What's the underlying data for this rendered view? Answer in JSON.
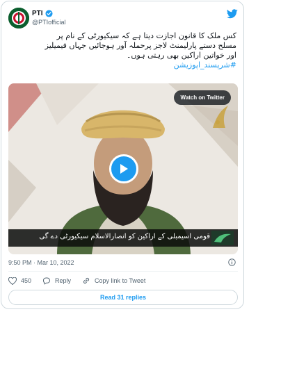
{
  "tweet": {
    "author_name": "PTI",
    "author_handle": "@PTIofficial",
    "text_line1": "کس ملک کا قانون اجازت دیتا ہے کہ سیکیورٹی کے نام پر",
    "text_line2": "مسلح دستے پارلیمنٹ لاجز پرحملہ آور ہوجائیں جہاں فیمیلیز",
    "text_line3": "اور خواتین اراکین بھی رہتی ہوں۔",
    "hashtag": "#شرپسند_اپوزیشن",
    "timestamp": "9:50 PM · Mar 10, 2022"
  },
  "video": {
    "watch_label": "Watch on Twitter",
    "caption": "قومی اسیمبلی کے اراکین کو انصارالاسلام سیکیورٹی دے گی"
  },
  "actions": {
    "likes_count": "450",
    "reply_label": "Reply",
    "copy_label": "Copy link to Tweet"
  },
  "footer": {
    "read_replies_label": "Read 31 replies"
  },
  "colors": {
    "accent": "#1d9bf0",
    "secondary_text": "#536471",
    "border": "#cfd9de"
  },
  "icons": [
    "verified-badge-icon",
    "twitter-bird-icon",
    "play-icon",
    "info-icon",
    "heart-icon",
    "reply-icon",
    "link-icon"
  ]
}
